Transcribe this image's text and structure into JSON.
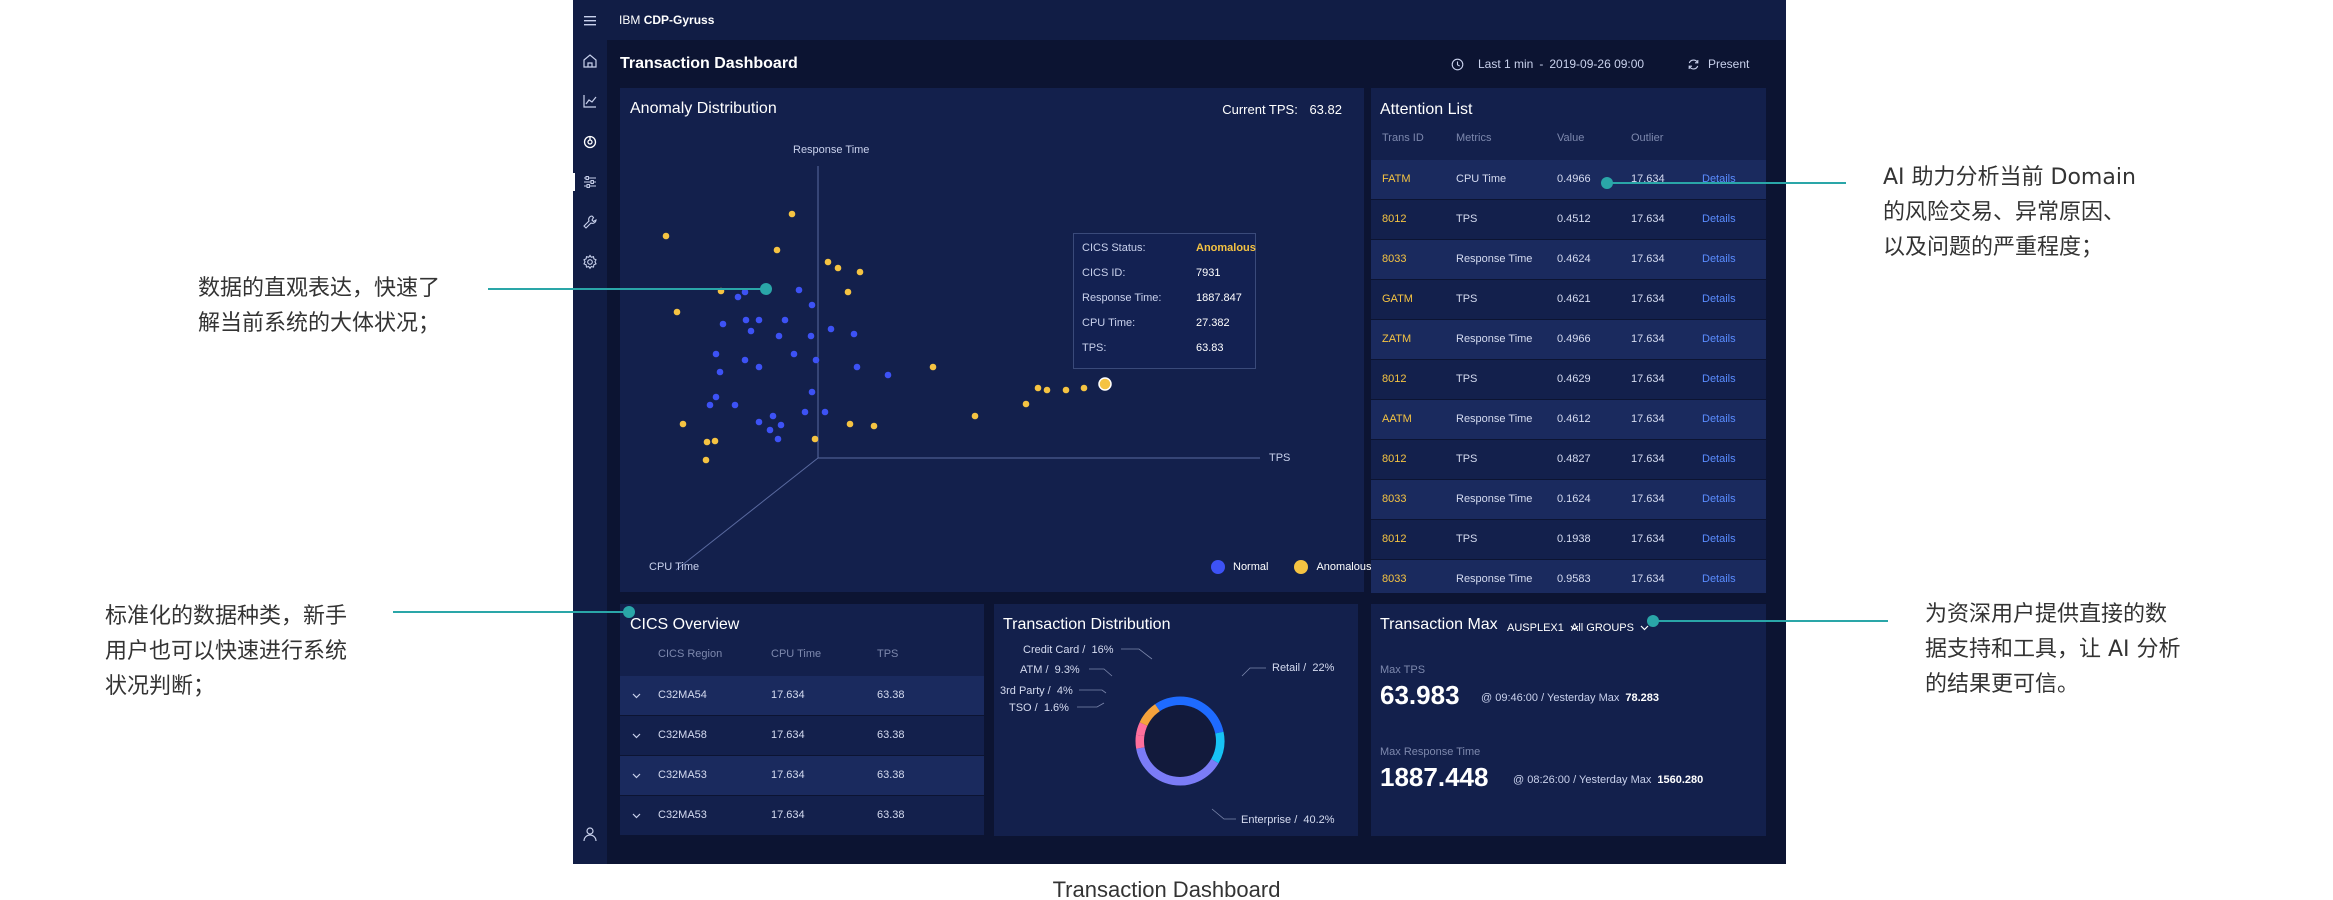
{
  "topbar": {
    "brand_prefix": "IBM",
    "brand_name": "CDP-Gyruss"
  },
  "header": {
    "title": "Transaction Dashboard",
    "time_range": "Last 1 min",
    "time_sep": "-",
    "time_value": "2019-09-26 09:00",
    "present_label": "Present"
  },
  "anomaly": {
    "title": "Anomaly Distribution",
    "current_tps_label": "Current TPS:",
    "current_tps_value": "63.82",
    "axis_z": "Response Time",
    "axis_x": "TPS",
    "axis_y": "CPU Time",
    "legend_normal": "Normal",
    "legend_anomalous": "Anomalous",
    "colors": {
      "normal": "#3d52f5",
      "anomalous": "#f5c342"
    },
    "tooltip": {
      "status_label": "CICS Status:",
      "status_value": "Anomalous",
      "id_label": "CICS ID:",
      "id_value": "7931",
      "rt_label": "Response Time:",
      "rt_value": "1887.847",
      "cpu_label": "CPU Time:",
      "cpu_value": "27.382",
      "tps_label": "TPS:",
      "tps_value": "63.83"
    }
  },
  "attention": {
    "title": "Attention List",
    "headers": {
      "trans_id": "Trans ID",
      "metrics": "Metrics",
      "value": "Value",
      "outlier": "Outlier"
    },
    "rows": [
      {
        "id": "FATM",
        "metric": "CPU Time",
        "value": "0.4966",
        "outlier": "17.634",
        "link": "Details"
      },
      {
        "id": "8012",
        "metric": "TPS",
        "value": "0.4512",
        "outlier": "17.634",
        "link": "Details"
      },
      {
        "id": "8033",
        "metric": "Response Time",
        "value": "0.4624",
        "outlier": "17.634",
        "link": "Details"
      },
      {
        "id": "GATM",
        "metric": "TPS",
        "value": "0.4621",
        "outlier": "17.634",
        "link": "Details"
      },
      {
        "id": "ZATM",
        "metric": "Response Time",
        "value": "0.4966",
        "outlier": "17.634",
        "link": "Details"
      },
      {
        "id": "8012",
        "metric": "TPS",
        "value": "0.4629",
        "outlier": "17.634",
        "link": "Details"
      },
      {
        "id": "AATM",
        "metric": "Response Time",
        "value": "0.4612",
        "outlier": "17.634",
        "link": "Details"
      },
      {
        "id": "8012",
        "metric": "TPS",
        "value": "0.4827",
        "outlier": "17.634",
        "link": "Details"
      },
      {
        "id": "8033",
        "metric": "Response Time",
        "value": "0.1624",
        "outlier": "17.634",
        "link": "Details"
      },
      {
        "id": "8012",
        "metric": "TPS",
        "value": "0.1938",
        "outlier": "17.634",
        "link": "Details"
      },
      {
        "id": "8033",
        "metric": "Response Time",
        "value": "0.9583",
        "outlier": "17.634",
        "link": "Details"
      }
    ]
  },
  "cics": {
    "title": "CICS Overview",
    "headers": {
      "region": "CICS Region",
      "cpu": "CPU Time",
      "tps": "TPS"
    },
    "rows": [
      {
        "region": "C32MA54",
        "cpu": "17.634",
        "tps": "63.38"
      },
      {
        "region": "C32MA58",
        "cpu": "17.634",
        "tps": "63.38"
      },
      {
        "region": "C32MA53",
        "cpu": "17.634",
        "tps": "63.38"
      },
      {
        "region": "C32MA53",
        "cpu": "17.634",
        "tps": "63.38"
      }
    ]
  },
  "distribution": {
    "title": "Transaction Distribution",
    "labels": [
      {
        "name": "Credit Card /",
        "pct": "16%"
      },
      {
        "name": "ATM /",
        "pct": "9.3%"
      },
      {
        "name": "3rd Party /",
        "pct": "4%"
      },
      {
        "name": "TSO /",
        "pct": "1.6%"
      },
      {
        "name": "Retail /",
        "pct": "22%"
      },
      {
        "name": "Enterprise /",
        "pct": "40.2%"
      }
    ],
    "colors": {
      "blue": "#1e6bff",
      "cyan": "#17c3f5",
      "purple": "#7b7cf6",
      "orange": "#f5a23c",
      "pink": "#ff6f9c",
      "center": "#121a3c"
    }
  },
  "max": {
    "title": "Transaction Max",
    "dropdown1": "AUSPLEX1",
    "dropdown2": "All GROUPS",
    "tps_label": "Max TPS",
    "tps_value": "63.983",
    "tps_sub": "@ 09:46:00 / Yesterday Max",
    "tps_yest": "78.283",
    "rt_label": "Max Response Time",
    "rt_value": "1887.448",
    "rt_sub": "@ 08:26:00 / Yesterday Max",
    "rt_yest": "1560.280"
  },
  "annotations": {
    "a1_line1": "数据的直观表达，快速了",
    "a1_line2": "解当前系统的大体状况；",
    "a2_line1": "标准化的数据种类，新手",
    "a2_line2": "用户也可以快速进行系统",
    "a2_line3": "状况判断；",
    "a3_line1": "AI 助力分析当前 Domain",
    "a3_line2": "的风险交易、异常原因、",
    "a3_line3": "以及问题的严重程度；",
    "a4_line1": "为资深用户提供直接的数",
    "a4_line2": "据支持和工具，让 AI 分析",
    "a4_line3": "的结果更可信。",
    "caption": "Transaction Dashboard"
  }
}
